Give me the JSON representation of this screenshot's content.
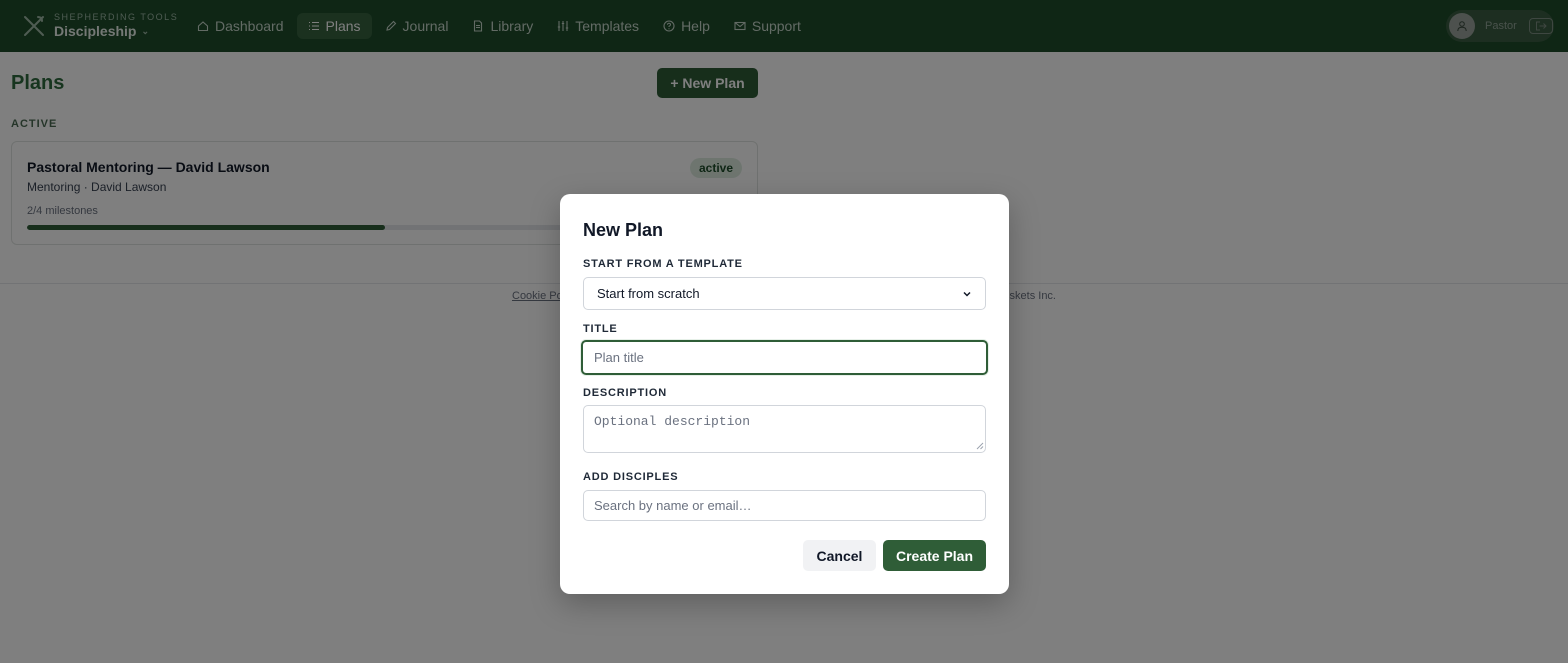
{
  "brand": {
    "subtitle": "SHEPHERDING TOOLS",
    "name": "Discipleship",
    "logo_icon": "crossed-staff-icon"
  },
  "nav": {
    "items": [
      {
        "label": "Dashboard",
        "icon": "home-icon",
        "active": false
      },
      {
        "label": "Plans",
        "icon": "list-icon",
        "active": true
      },
      {
        "label": "Journal",
        "icon": "pencil-icon",
        "active": false
      },
      {
        "label": "Library",
        "icon": "document-icon",
        "active": false
      },
      {
        "label": "Templates",
        "icon": "sliders-icon",
        "active": false
      },
      {
        "label": "Help",
        "icon": "help-circle-icon",
        "active": false
      },
      {
        "label": "Support",
        "icon": "mail-icon",
        "active": false
      }
    ]
  },
  "user": {
    "name": "Pastor",
    "avatar_icon": "user-icon",
    "logout_icon": "logout-icon"
  },
  "page": {
    "title": "Plans",
    "new_plan_label": "+ New Plan",
    "section_active": "ACTIVE"
  },
  "plans": [
    {
      "title": "Pastoral Mentoring — David Lawson",
      "meta": "Mentoring · David Lawson",
      "progress_text": "2/4 milestones",
      "progress": 0.5,
      "status": "active"
    }
  ],
  "footer": {
    "left": "Cookie Po",
    "right": "skets Inc."
  },
  "modal": {
    "title": "New Plan",
    "template_label": "START FROM A TEMPLATE",
    "template_value": "Start from scratch",
    "title_label": "TITLE",
    "title_placeholder": "Plan title",
    "description_label": "DESCRIPTION",
    "description_placeholder": "Optional description",
    "disciples_label": "ADD DISCIPLES",
    "disciples_placeholder": "Search by name or email…",
    "cancel_label": "Cancel",
    "create_label": "Create Plan"
  },
  "colors": {
    "nav_bg": "#1e4d2b",
    "accent": "#2f5d37",
    "title_green": "#2f6b3e"
  }
}
